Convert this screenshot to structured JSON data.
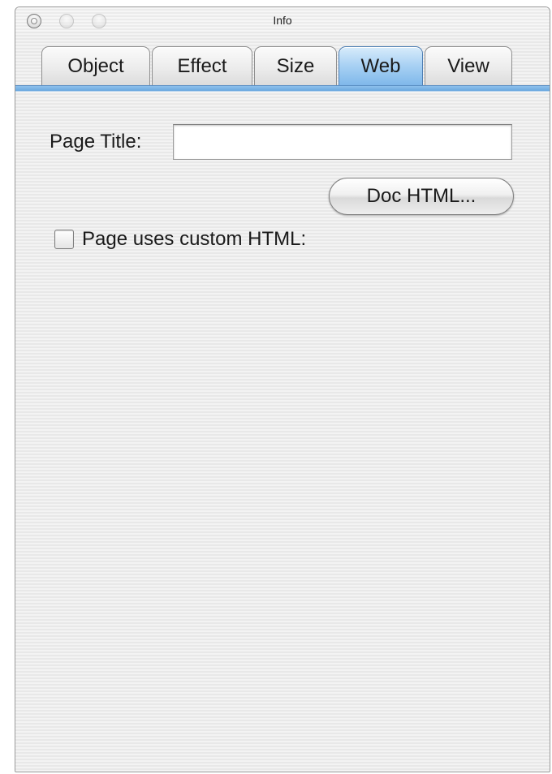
{
  "window": {
    "title": "Info"
  },
  "tabs": [
    {
      "label": "Object",
      "active": false
    },
    {
      "label": "Effect",
      "active": false
    },
    {
      "label": "Size",
      "active": false
    },
    {
      "label": "Web",
      "active": true
    },
    {
      "label": "View",
      "active": false
    }
  ],
  "form": {
    "page_title_label": "Page Title:",
    "page_title_value": "",
    "doc_html_button": "Doc HTML...",
    "custom_html_label": "Page uses custom HTML:",
    "custom_html_checked": false
  },
  "colors": {
    "active_tab": "#a7d0f3",
    "tab_underline": "#6aa8df"
  }
}
